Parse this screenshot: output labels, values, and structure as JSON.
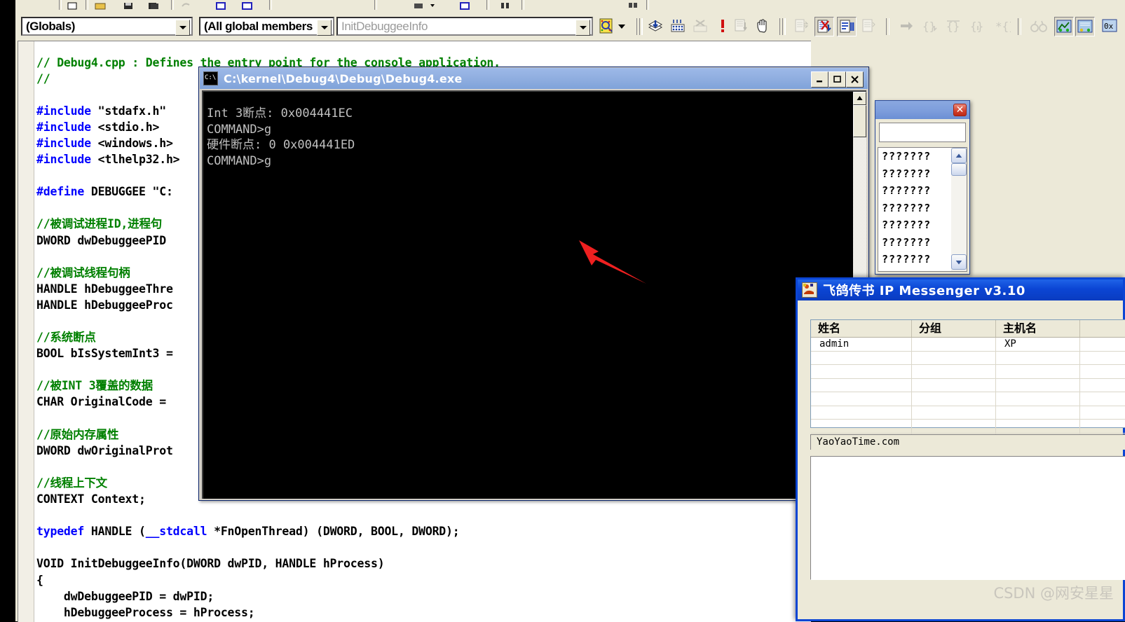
{
  "ide": {
    "combo_class": "(Globals)",
    "combo_members": "(All global members",
    "combo_function_placeholder": "InitDebuggeeInfo",
    "toolbar_icons": [
      "insert-remove-breakpoint-icon",
      "breakpoints-icon",
      "remove-all-breakpoints-icon",
      "exception-icon",
      "watch-list-icon",
      "hand-icon",
      "step-into-icon",
      "step-out-no-icon",
      "step-over-icon",
      "run-to-cursor-icon",
      "next-statement-icon",
      "trace-into-icon",
      "step-over-arrow-icon",
      "step-out-arrow-icon",
      "run-to-cursor-arrow-icon",
      "binoculars-icon",
      "watch-window-icon",
      "variables-window-icon",
      "registers-window-icon"
    ]
  },
  "code": {
    "lines": [
      [
        [
          "com",
          "// Debug4.cpp : Defines the entry point for the console application."
        ]
      ],
      [
        [
          "com",
          "//"
        ]
      ],
      [
        [
          "txt",
          ""
        ]
      ],
      [
        [
          "key",
          "#include"
        ],
        [
          "txt",
          " \"stdafx.h\""
        ]
      ],
      [
        [
          "key",
          "#include"
        ],
        [
          "txt",
          " <stdio.h>"
        ]
      ],
      [
        [
          "key",
          "#include"
        ],
        [
          "txt",
          " <windows.h>"
        ]
      ],
      [
        [
          "key",
          "#include"
        ],
        [
          "txt",
          " <tlhelp32.h>"
        ]
      ],
      [
        [
          "txt",
          ""
        ]
      ],
      [
        [
          "key",
          "#define"
        ],
        [
          "txt",
          " DEBUGGEE \"C:"
        ]
      ],
      [
        [
          "txt",
          ""
        ]
      ],
      [
        [
          "com",
          "//被调试进程ID,进程句"
        ]
      ],
      [
        [
          "txt",
          "DWORD dwDebuggeePID"
        ]
      ],
      [
        [
          "txt",
          ""
        ]
      ],
      [
        [
          "com",
          "//被调试线程句柄"
        ]
      ],
      [
        [
          "txt",
          "HANDLE hDebuggeeThre"
        ]
      ],
      [
        [
          "txt",
          "HANDLE hDebuggeeProc"
        ]
      ],
      [
        [
          "txt",
          ""
        ]
      ],
      [
        [
          "com",
          "//系统断点"
        ]
      ],
      [
        [
          "txt",
          "BOOL bIsSystemInt3 ="
        ]
      ],
      [
        [
          "txt",
          ""
        ]
      ],
      [
        [
          "com",
          "//被INT 3覆盖的数据"
        ]
      ],
      [
        [
          "txt",
          "CHAR OriginalCode ="
        ]
      ],
      [
        [
          "txt",
          ""
        ]
      ],
      [
        [
          "com",
          "//原始内存属性"
        ]
      ],
      [
        [
          "txt",
          "DWORD dwOriginalProt"
        ]
      ],
      [
        [
          "txt",
          ""
        ]
      ],
      [
        [
          "com",
          "//线程上下文"
        ]
      ],
      [
        [
          "txt",
          "CONTEXT Context;"
        ]
      ],
      [
        [
          "txt",
          ""
        ]
      ],
      [
        [
          "key",
          "typedef"
        ],
        [
          "txt",
          " HANDLE ("
        ],
        [
          "key",
          "__stdcall"
        ],
        [
          "txt",
          " *FnOpenThread) (DWORD, BOOL, DWORD);"
        ]
      ],
      [
        [
          "txt",
          ""
        ]
      ],
      [
        [
          "txt",
          "VOID InitDebuggeeInfo(DWORD dwPID, HANDLE hProcess)"
        ]
      ],
      [
        [
          "txt",
          "{"
        ]
      ],
      [
        [
          "txt",
          "    dwDebuggeePID = dwPID;"
        ]
      ],
      [
        [
          "txt",
          "    hDebuggeeProcess = hProcess;"
        ]
      ]
    ]
  },
  "console": {
    "title": "C:\\kernel\\Debug4\\Debug\\Debug4.exe",
    "icon": "console-icon",
    "minimize": "–",
    "maximize": "❐",
    "close": "✕",
    "output": "Int 3断点: 0x004441EC\nCOMMAND>g\n硬件断点: 0 0x004441ED\nCOMMAND>g"
  },
  "qdialog": {
    "close_label": "✕",
    "input_value": "",
    "items": [
      "???????",
      "???????",
      "???????",
      "???????",
      "???????",
      "???????",
      "???????"
    ],
    "scroll_up": "▲",
    "scroll_down": "▼"
  },
  "ipmessenger": {
    "title": "飞鸽传书  IP Messenger  v3.10",
    "columns": [
      "姓名",
      "分组",
      "主机名",
      ""
    ],
    "rows": [
      [
        "admin",
        "",
        "XP",
        ""
      ],
      [
        "",
        "",
        "",
        ""
      ],
      [
        "",
        "",
        "",
        ""
      ],
      [
        "",
        "",
        "",
        ""
      ],
      [
        "",
        "",
        "",
        ""
      ],
      [
        "",
        "",
        "",
        ""
      ],
      [
        "",
        "",
        "",
        ""
      ],
      [
        "",
        "",
        "",
        ""
      ]
    ],
    "status": "YaoYaoTime.com",
    "message_body": ""
  },
  "watermark": "CSDN @网安星星",
  "colors": {
    "ide_face": "#ece9d8",
    "console_title": "#90aee0",
    "ipm_title": "#0b45d4",
    "comment_green": "#008000",
    "keyword_blue": "#0000ff",
    "arrow_red": "#ef2020"
  }
}
